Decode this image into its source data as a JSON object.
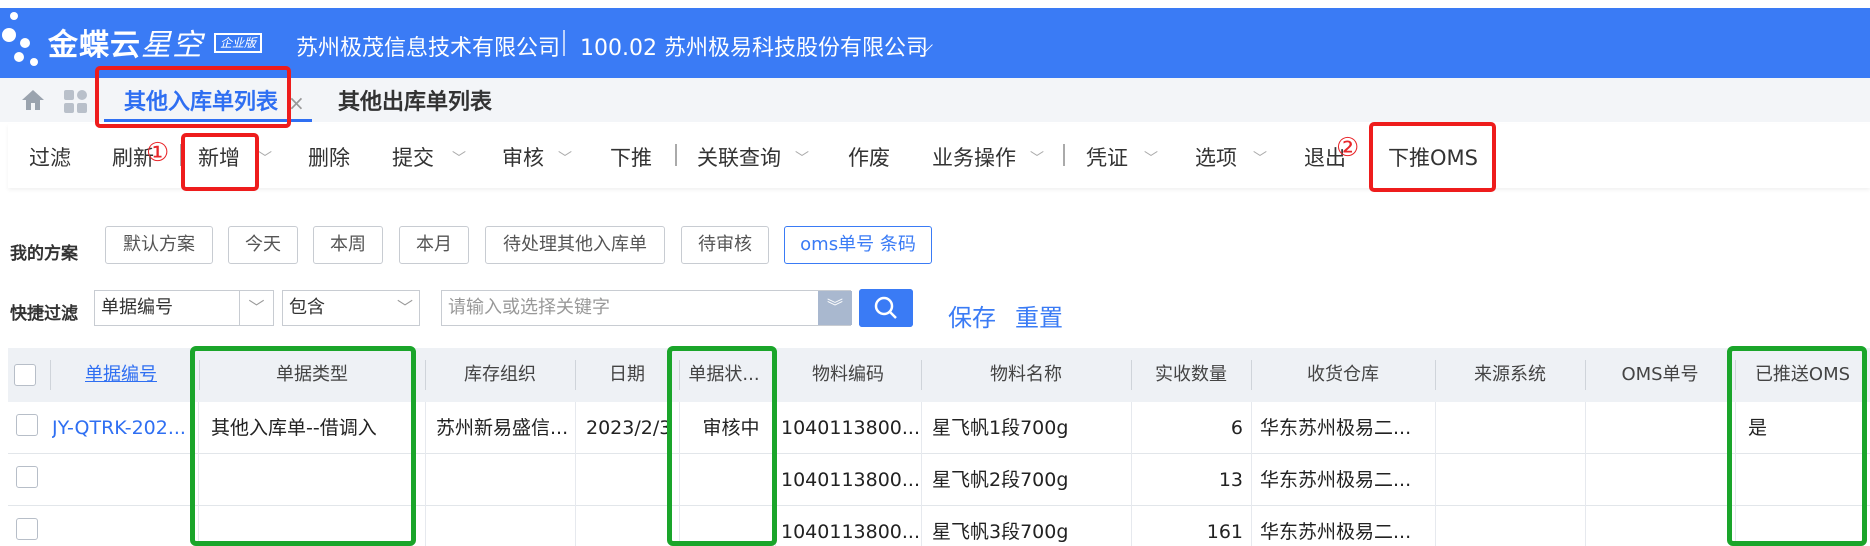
{
  "header": {
    "logo_main": "金蝶云",
    "logo_sub": "星空",
    "logo_badge": "企业版",
    "company": "苏州极茂信息技术有限公司",
    "org": "100.02 苏州极易科技股份有限公司"
  },
  "tabs": [
    {
      "label": "其他入库单列表",
      "active": true
    },
    {
      "label": "其他出库单列表",
      "active": false
    }
  ],
  "toolbar": {
    "filter": "过滤",
    "refresh": "刷新",
    "add": "新增",
    "delete": "删除",
    "submit": "提交",
    "audit": "审核",
    "push": "下推",
    "related_query": "关联查询",
    "void": "作废",
    "biz_ops": "业务操作",
    "voucher": "凭证",
    "options": "选项",
    "exit": "退出",
    "push_oms": "下推OMS"
  },
  "annotations": {
    "mark1": "①",
    "mark2": "②"
  },
  "schemes": {
    "label": "我的方案",
    "items": [
      "默认方案",
      "今天",
      "本周",
      "本月",
      "待处理其他入库单",
      "待审核",
      "oms单号 条码"
    ],
    "active": "oms单号 条码"
  },
  "quick_filter": {
    "label": "快捷过滤",
    "field": "单据编号",
    "operator": "包含",
    "placeholder": "请输入或选择关键字",
    "save": "保存",
    "reset": "重置"
  },
  "grid": {
    "columns": [
      "单据编号",
      "单据类型",
      "库存组织",
      "日期",
      "单据状...",
      "物料编码",
      "物料名称",
      "实收数量",
      "收货仓库",
      "来源系统",
      "OMS单号",
      "已推送OMS"
    ],
    "rows": [
      {
        "bill_no": "JY-QTRK-202...",
        "bill_type": "其他入库单--借调入",
        "org": "苏州新易盛信...",
        "date": "2023/2/3",
        "status": "审核中",
        "material_code": "1040113800...",
        "material_name": "星飞帆1段700g",
        "qty": "6",
        "warehouse": "华东苏州极易二...",
        "source": "",
        "oms_no": "",
        "pushed": "是"
      },
      {
        "bill_no": "",
        "bill_type": "",
        "org": "",
        "date": "",
        "status": "",
        "material_code": "1040113800...",
        "material_name": "星飞帆2段700g",
        "qty": "13",
        "warehouse": "华东苏州极易二...",
        "source": "",
        "oms_no": "",
        "pushed": ""
      },
      {
        "bill_no": "",
        "bill_type": "",
        "org": "",
        "date": "",
        "status": "",
        "material_code": "1040113800...",
        "material_name": "星飞帆3段700g",
        "qty": "161",
        "warehouse": "华东苏州极易二...",
        "source": "",
        "oms_no": "",
        "pushed": ""
      }
    ]
  },
  "colors": {
    "brand": "#3a7bf5",
    "annotation_red": "#ee1c1c",
    "annotation_green": "#1aa52a"
  }
}
